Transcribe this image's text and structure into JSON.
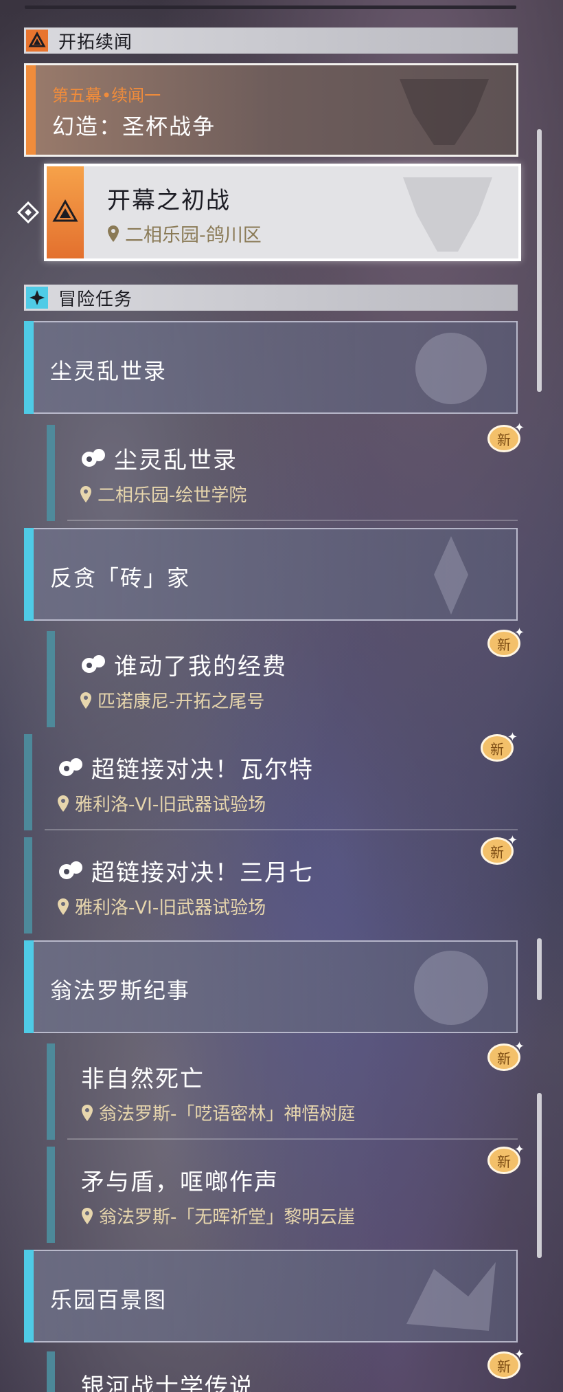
{
  "sections": {
    "trailblaze": {
      "label": "开拓续闻"
    },
    "adventure": {
      "label": "冒险任务"
    }
  },
  "story": {
    "subtitle": "第五幕•续闻一",
    "title": "幻造：圣杯战争"
  },
  "selected_task": {
    "title": "开幕之初战",
    "location": "二相乐园-鸽川区"
  },
  "groups": [
    {
      "title": "尘灵乱世录",
      "tasks": [
        {
          "title": "尘灵乱世录",
          "location": "二相乐园-绘世学院",
          "badge": "新"
        }
      ]
    },
    {
      "title": "反贪「砖」家",
      "tasks": [
        {
          "title": "谁动了我的经费",
          "location": "匹诺康尼-开拓之尾号",
          "badge": "新"
        },
        {
          "title": "超链接对决！瓦尔特",
          "location": "雅利洛-VI-旧武器试验场",
          "badge": "新"
        },
        {
          "title": "超链接对决！三月七",
          "location": "雅利洛-VI-旧武器试验场",
          "badge": "新"
        }
      ]
    },
    {
      "title": "翁法罗斯纪事",
      "tasks": [
        {
          "title": "非自然死亡",
          "location": "翁法罗斯-「呓语密林」神悟树庭",
          "badge": "新"
        },
        {
          "title": "矛与盾，哐啷作声",
          "location": "翁法罗斯-「无晖祈堂」黎明云崖",
          "badge": "新"
        }
      ]
    },
    {
      "title": "乐园百景图",
      "tasks": [
        {
          "title": "银河战士学传说",
          "location": "",
          "badge": "新"
        }
      ]
    }
  ],
  "colors": {
    "story_accent": "#f08c3b",
    "group_accent": "#4fcbe6",
    "location_text": "#e7d6ad",
    "badge": "#f3c06a"
  }
}
